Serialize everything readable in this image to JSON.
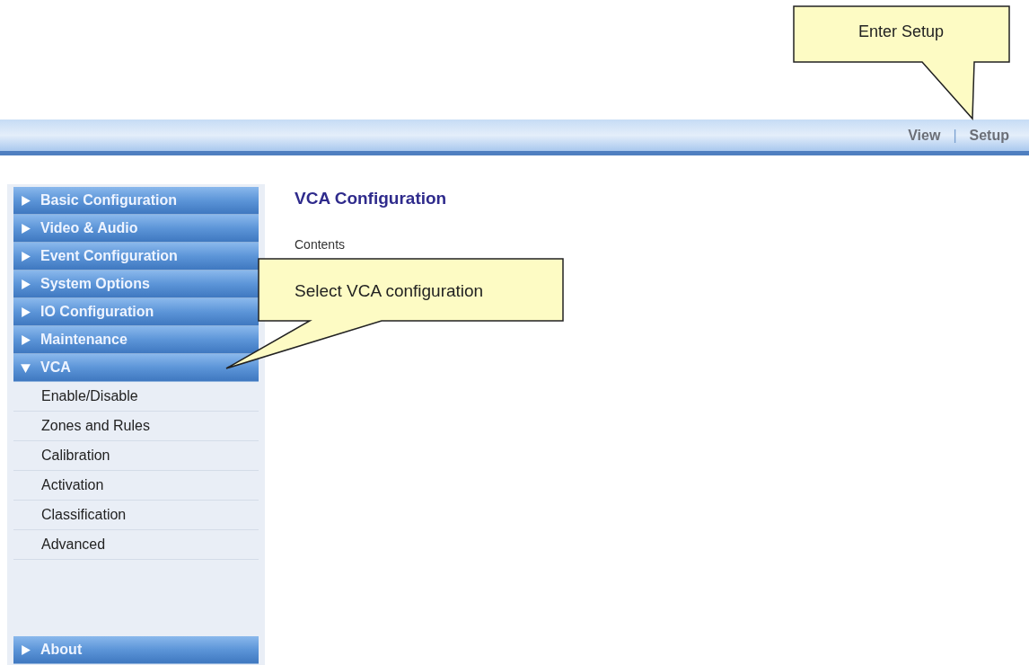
{
  "callouts": [
    {
      "text": "Enter Setup"
    },
    {
      "text": "Select VCA configuration"
    }
  ],
  "top_nav": {
    "links": [
      "View",
      "Setup"
    ],
    "separator": "|"
  },
  "sidebar": {
    "sections": [
      {
        "label": "Basic Configuration",
        "expanded": false
      },
      {
        "label": "Video & Audio",
        "expanded": false
      },
      {
        "label": "Event Configuration",
        "expanded": false
      },
      {
        "label": "System Options",
        "expanded": false
      },
      {
        "label": "IO Configuration",
        "expanded": false
      },
      {
        "label": "Maintenance",
        "expanded": false
      },
      {
        "label": "VCA",
        "expanded": true,
        "children": [
          "Enable/Disable",
          "Zones and Rules",
          "Calibration",
          "Activation",
          "Classification",
          "Advanced"
        ]
      }
    ],
    "bottom_sections": [
      {
        "label": "About",
        "expanded": false
      }
    ]
  },
  "content": {
    "title": "VCA Configuration",
    "subtitle": "Contents"
  }
}
